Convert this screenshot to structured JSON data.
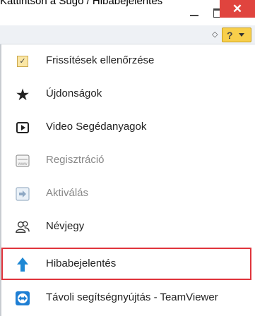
{
  "window": {
    "title": "Kattintson a Súgó / Hibabejelentés",
    "minimize": "minimize",
    "maximize": "maximize",
    "close": "✕"
  },
  "toolbar": {
    "collapse_glyph": "◇",
    "help_label": "?"
  },
  "menu": {
    "items": [
      {
        "label": "Frissítések ellenőrzése",
        "icon": "checkbox-icon",
        "enabled": true
      },
      {
        "label": "Újdonságok",
        "icon": "star-icon",
        "enabled": true
      },
      {
        "label": "Video Segédanyagok",
        "icon": "video-play-icon",
        "enabled": true
      },
      {
        "label": "Regisztráció",
        "icon": "registration-icon",
        "enabled": false
      },
      {
        "label": "Aktiválás",
        "icon": "arrow-right-icon",
        "enabled": false
      },
      {
        "label": "Névjegy",
        "icon": "people-icon",
        "enabled": true
      },
      {
        "label": "Hibabejelentés",
        "icon": "arrow-up-icon",
        "enabled": true,
        "highlighted": true
      },
      {
        "label": "Távoli segítségnyújtás - TeamViewer",
        "icon": "teamviewer-icon",
        "enabled": true
      }
    ]
  },
  "colors": {
    "highlight_border": "#e0343c",
    "close_button": "#e0443e",
    "help_button": "#f8cf4b",
    "arrow_blue": "#1f88d4"
  }
}
